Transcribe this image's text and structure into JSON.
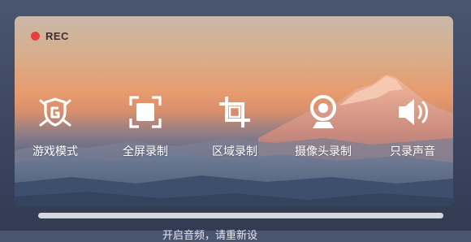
{
  "recording": {
    "label": "REC",
    "dot_color": "#e8403b"
  },
  "modes": [
    {
      "label": "游戏模式",
      "icon": "gamepad-shield-icon"
    },
    {
      "label": "全屏录制",
      "icon": "fullscreen-icon"
    },
    {
      "label": "区域录制",
      "icon": "crop-icon"
    },
    {
      "label": "摄像头录制",
      "icon": "webcam-icon"
    },
    {
      "label": "只录声音",
      "icon": "speaker-icon"
    }
  ],
  "footer": {
    "text": "开启音频，请重新设"
  }
}
